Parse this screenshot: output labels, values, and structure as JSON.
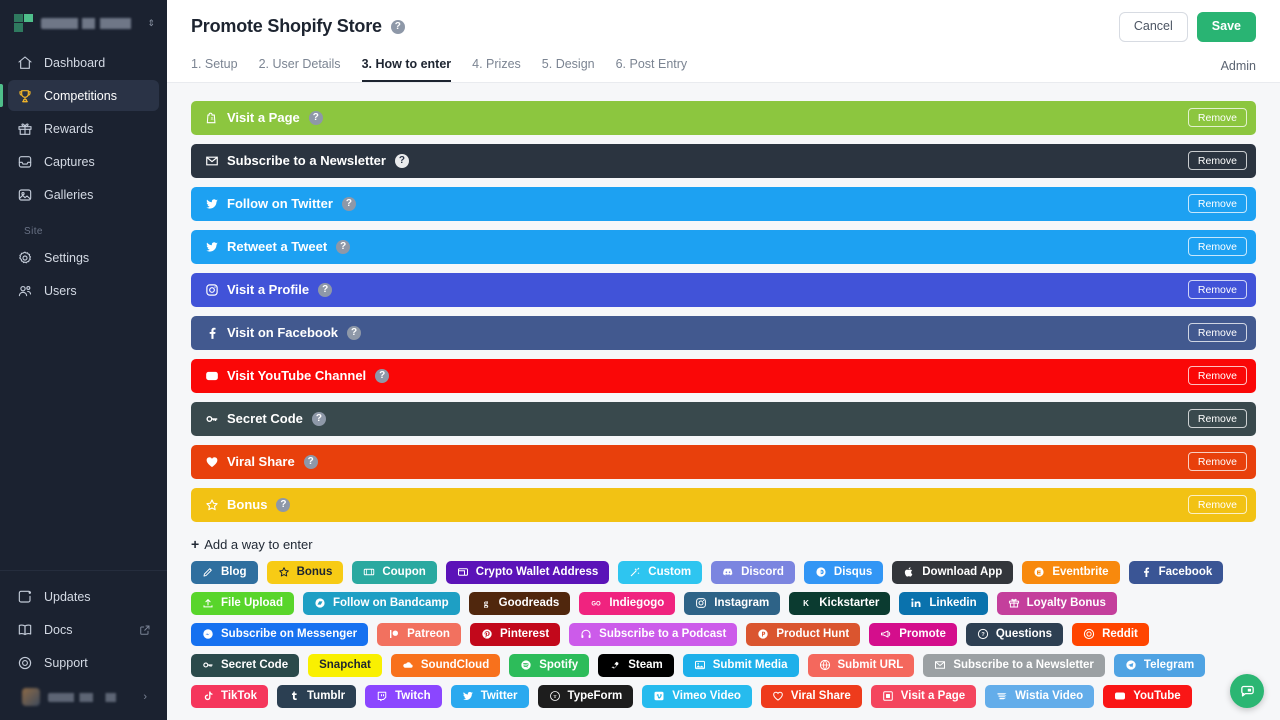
{
  "sidebar": {
    "brand": {
      "name_redacted": true,
      "caret_icon": "chevron-updown-icon"
    },
    "items": [
      {
        "label": "Dashboard",
        "icon": "home-icon",
        "active": false
      },
      {
        "label": "Competitions",
        "icon": "trophy-icon",
        "active": true
      },
      {
        "label": "Rewards",
        "icon": "gift-icon",
        "active": false
      },
      {
        "label": "Captures",
        "icon": "inbox-icon",
        "active": false
      },
      {
        "label": "Galleries",
        "icon": "image-icon",
        "active": false
      }
    ],
    "section_label": "Site",
    "site_items": [
      {
        "label": "Settings",
        "icon": "gear-icon"
      },
      {
        "label": "Users",
        "icon": "users-icon"
      }
    ],
    "bottom_items": [
      {
        "label": "Updates",
        "icon": "megaphone-icon",
        "external": false
      },
      {
        "label": "Docs",
        "icon": "book-icon",
        "external": true
      },
      {
        "label": "Support",
        "icon": "lifebuoy-icon",
        "external": false
      }
    ]
  },
  "header": {
    "title": "Promote Shopify Store",
    "help_icon": "question-circle-icon",
    "cancel_label": "Cancel",
    "save_label": "Save",
    "admin_label": "Admin",
    "save_color": "#29b473"
  },
  "tabs": [
    {
      "label": "1. Setup",
      "active": false
    },
    {
      "label": "2. User Details",
      "active": false
    },
    {
      "label": "3. How to enter",
      "active": true
    },
    {
      "label": "4. Prizes",
      "active": false
    },
    {
      "label": "5. Design",
      "active": false
    },
    {
      "label": "6. Post Entry",
      "active": false
    }
  ],
  "methods": {
    "remove_label": "Remove",
    "items": [
      {
        "label": "Visit a Page",
        "icon": "shopify-bag-icon",
        "color": "#8cc63f",
        "dark_help": false
      },
      {
        "label": "Subscribe to a Newsletter",
        "icon": "envelope-icon",
        "color": "#2b3440",
        "dark_help": true
      },
      {
        "label": "Follow on Twitter",
        "icon": "twitter-bird-icon",
        "color": "#1da1f2",
        "dark_help": false
      },
      {
        "label": "Retweet a Tweet",
        "icon": "twitter-bird-icon",
        "color": "#1da1f2",
        "dark_help": false
      },
      {
        "label": "Visit a Profile",
        "icon": "instagram-icon",
        "color": "#4153d8",
        "dark_help": false
      },
      {
        "label": "Visit on Facebook",
        "icon": "facebook-f-icon",
        "color": "#42598f",
        "dark_help": false
      },
      {
        "label": "Visit YouTube Channel",
        "icon": "youtube-icon",
        "color": "#fa0707",
        "dark_help": false
      },
      {
        "label": "Secret Code",
        "icon": "key-icon",
        "color": "#39494d",
        "dark_help": false
      },
      {
        "label": "Viral Share",
        "icon": "heart-icon",
        "color": "#e8400c",
        "dark_help": false
      },
      {
        "label": "Bonus",
        "icon": "star-outline-icon",
        "color": "#f2c214",
        "dark_help": false
      }
    ]
  },
  "add_section": {
    "plus": "+",
    "label": "Add a way to enter",
    "tags": [
      {
        "label": "Blog",
        "icon": "pencil-icon",
        "color": "#2f6f9f",
        "text": "#ffffff"
      },
      {
        "label": "Bonus",
        "icon": "star-outline-icon",
        "color": "#f7cb15",
        "text": "#1d2430"
      },
      {
        "label": "Coupon",
        "icon": "ticket-icon",
        "color": "#2aa9a0",
        "text": "#ffffff"
      },
      {
        "label": "Crypto Wallet Address",
        "icon": "wallet-icon",
        "color": "#5b13b8",
        "text": "#ffffff"
      },
      {
        "label": "Custom",
        "icon": "wand-icon",
        "color": "#2ec5f0",
        "text": "#ffffff"
      },
      {
        "label": "Discord",
        "icon": "discord-icon",
        "color": "#7b85e0",
        "text": "#ffffff"
      },
      {
        "label": "Disqus",
        "icon": "disqus-icon",
        "color": "#3296f5",
        "text": "#ffffff"
      },
      {
        "label": "Download App",
        "icon": "apple-icon",
        "color": "#33363b",
        "text": "#ffffff"
      },
      {
        "label": "Eventbrite",
        "icon": "eventbrite-icon",
        "color": "#f8890d",
        "text": "#ffffff"
      },
      {
        "label": "Facebook",
        "icon": "facebook-f-icon",
        "color": "#3a5595",
        "text": "#ffffff"
      },
      {
        "label": "File Upload",
        "icon": "upload-icon",
        "color": "#58d52b",
        "text": "#ffffff"
      },
      {
        "label": "Follow on Bandcamp",
        "icon": "bandcamp-icon",
        "color": "#1e9fc4",
        "text": "#ffffff"
      },
      {
        "label": "Goodreads",
        "icon": "goodreads-g-icon",
        "color": "#50270d",
        "text": "#ffffff"
      },
      {
        "label": "Indiegogo",
        "icon": "indiegogo-go-icon",
        "color": "#f0237f",
        "text": "#ffffff"
      },
      {
        "label": "Instagram",
        "icon": "instagram-icon",
        "color": "#2e6387",
        "text": "#ffffff"
      },
      {
        "label": "Kickstarter",
        "icon": "kickstarter-k-icon",
        "color": "#0b3b30",
        "text": "#ffffff"
      },
      {
        "label": "Linkedin",
        "icon": "linkedin-in-icon",
        "color": "#0a72ad",
        "text": "#ffffff"
      },
      {
        "label": "Loyalty Bonus",
        "icon": "gift-icon",
        "color": "#c43f9c",
        "text": "#ffffff"
      },
      {
        "label": "Subscribe on Messenger",
        "icon": "messenger-icon",
        "color": "#1671f0",
        "text": "#ffffff"
      },
      {
        "label": "Patreon",
        "icon": "patreon-icon",
        "color": "#f2715f",
        "text": "#ffffff"
      },
      {
        "label": "Pinterest",
        "icon": "pinterest-icon",
        "color": "#c2081b",
        "text": "#ffffff"
      },
      {
        "label": "Subscribe to a Podcast",
        "icon": "headphones-icon",
        "color": "#cc5bea",
        "text": "#ffffff"
      },
      {
        "label": "Product Hunt",
        "icon": "producthunt-icon",
        "color": "#da552f",
        "text": "#ffffff"
      },
      {
        "label": "Promote",
        "icon": "bullhorn-icon",
        "color": "#d40e8c",
        "text": "#ffffff"
      },
      {
        "label": "Questions",
        "icon": "question-circle-icon",
        "color": "#2d3f52",
        "text": "#ffffff"
      },
      {
        "label": "Reddit",
        "icon": "reddit-icon",
        "color": "#ff4500",
        "text": "#ffffff"
      },
      {
        "label": "Secret Code",
        "icon": "key-icon",
        "color": "#2b4a4b",
        "text": "#ffffff"
      },
      {
        "label": "Snapchat",
        "icon": "none",
        "color": "#f9f001",
        "text": "#1d2430"
      },
      {
        "label": "SoundCloud",
        "icon": "cloud-icon",
        "color": "#f8711c",
        "text": "#ffffff"
      },
      {
        "label": "Spotify",
        "icon": "spotify-icon",
        "color": "#2dbc5a",
        "text": "#ffffff"
      },
      {
        "label": "Steam",
        "icon": "steam-icon",
        "color": "#000000",
        "text": "#ffffff"
      },
      {
        "label": "Submit Media",
        "icon": "photo-icon",
        "color": "#1eb0ea",
        "text": "#ffffff"
      },
      {
        "label": "Submit URL",
        "icon": "globe-icon",
        "color": "#f4685d",
        "text": "#ffffff"
      },
      {
        "label": "Subscribe to a Newsletter",
        "icon": "envelope-icon",
        "color": "#9ba0a3",
        "text": "#ffffff"
      },
      {
        "label": "Telegram",
        "icon": "telegram-icon",
        "color": "#4fa3e3",
        "text": "#ffffff"
      },
      {
        "label": "TikTok",
        "icon": "tiktok-icon",
        "color": "#f5365c",
        "text": "#ffffff"
      },
      {
        "label": "Tumblr",
        "icon": "tumblr-t-icon",
        "color": "#2b3f52",
        "text": "#ffffff"
      },
      {
        "label": "Twitch",
        "icon": "twitch-icon",
        "color": "#8b46ff",
        "text": "#ffffff"
      },
      {
        "label": "Twitter",
        "icon": "twitter-bird-icon",
        "color": "#2aa9ef",
        "text": "#ffffff"
      },
      {
        "label": "TypeForm",
        "icon": "typeform-icon",
        "color": "#1d1d1d",
        "text": "#ffffff"
      },
      {
        "label": "Vimeo Video",
        "icon": "vimeo-icon",
        "color": "#26bbee",
        "text": "#ffffff"
      },
      {
        "label": "Viral Share",
        "icon": "heart-outline-icon",
        "color": "#ee3b1c",
        "text": "#ffffff"
      },
      {
        "label": "Visit a Page",
        "icon": "page-icon",
        "color": "#f4455e",
        "text": "#ffffff"
      },
      {
        "label": "Wistia Video",
        "icon": "wistia-icon",
        "color": "#63adea",
        "text": "#ffffff"
      },
      {
        "label": "YouTube",
        "icon": "youtube-icon",
        "color": "#fa1616",
        "text": "#ffffff"
      }
    ]
  },
  "fab": {
    "icon": "chat-bubble-icon",
    "color": "#2bb673"
  }
}
